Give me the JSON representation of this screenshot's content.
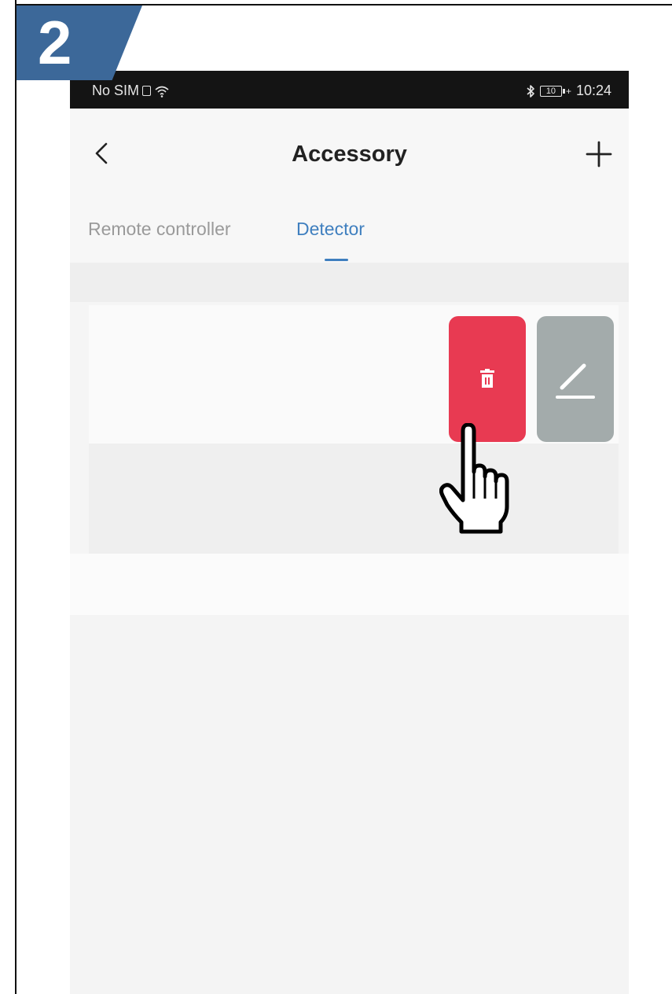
{
  "step": {
    "number": "2",
    "color": "#3c6899"
  },
  "status_bar": {
    "carrier": "No SIM",
    "battery": "10",
    "time": "10:24",
    "icons": [
      "sim-icon",
      "wifi-icon",
      "bluetooth-icon",
      "battery-icon",
      "charging-icon"
    ]
  },
  "header": {
    "title": "Accessory",
    "back_icon": "chevron-left-icon",
    "add_icon": "plus-icon"
  },
  "tabs": [
    {
      "label": "Remote controller",
      "active": false
    },
    {
      "label": "Detector",
      "active": true
    }
  ],
  "list": {
    "actions": [
      {
        "name": "delete",
        "icon": "trash-icon",
        "color": "#e83a52"
      },
      {
        "name": "edit",
        "icon": "pencil-icon",
        "color": "#a3abab"
      }
    ]
  },
  "colors": {
    "accent": "#3f7fbf",
    "delete": "#e83a52",
    "edit": "#a3abab",
    "status_bar": "#141414"
  }
}
